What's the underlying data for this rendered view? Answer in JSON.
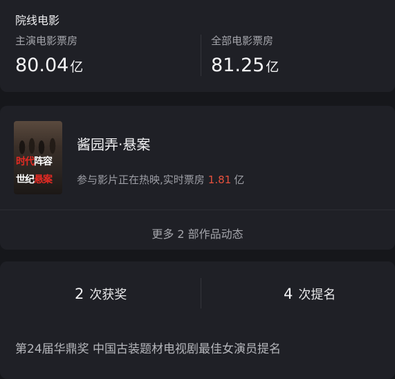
{
  "boxoffice": {
    "title": "院线电影",
    "lead": {
      "label": "主演电影票房",
      "value": "80.04",
      "unit": "亿"
    },
    "all": {
      "label": "全部电影票房",
      "value": "81.25",
      "unit": "亿"
    }
  },
  "works": {
    "poster": {
      "line1_red": "时代",
      "line1_white": "阵容",
      "line2_white": "世纪",
      "line2_red": "悬案"
    },
    "title": "酱园弄·悬案",
    "status_text": "参与影片正在热映,实时票房",
    "realtime_boxoffice": "1.81",
    "realtime_unit": "亿",
    "more_label": "更多 2 部作品动态"
  },
  "awards": {
    "wins_count": "2",
    "wins_label": "次获奖",
    "nominations_count": "4",
    "nominations_label": "次提名",
    "latest": "第24届华鼎奖  中国古装题材电视剧最佳女演员提名"
  },
  "colors": {
    "background": "#16171b",
    "card": "#1f2026",
    "highlight": "#e8503d"
  }
}
